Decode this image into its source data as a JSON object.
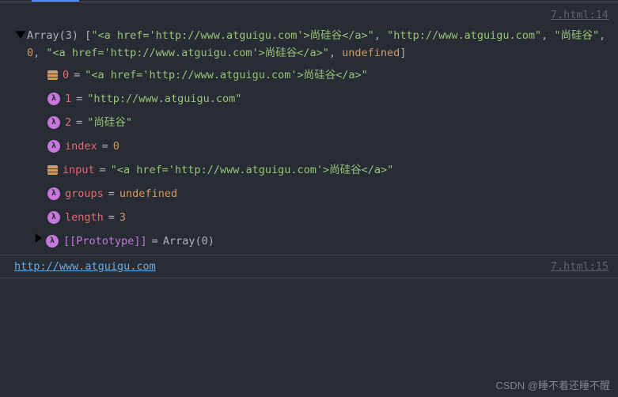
{
  "source1": "7.html:14",
  "source2": "7.html:15",
  "summary": {
    "prefix": "Array(3)",
    "items": [
      {
        "t": "string",
        "v": "\"<a href='http://www.atguigu.com'>尚硅谷</a>\""
      },
      {
        "t": "string",
        "v": "\"http://www.atguigu.com\""
      },
      {
        "t": "string",
        "v": "\"尚硅谷\""
      },
      {
        "t": "number",
        "v": "0"
      },
      {
        "t": "string",
        "v": "\"<a href='http://www.atguigu.com'>尚硅谷</a>\""
      },
      {
        "t": "undef",
        "v": "undefined"
      }
    ]
  },
  "props": [
    {
      "icon": "array",
      "key": "0",
      "val": "\"<a href='http://www.atguigu.com'>尚硅谷</a>\"",
      "vt": "string"
    },
    {
      "icon": "lambda",
      "key": "1",
      "val": "\"http://www.atguigu.com\"",
      "vt": "string"
    },
    {
      "icon": "lambda",
      "key": "2",
      "val": "\"尚硅谷\"",
      "vt": "string"
    },
    {
      "icon": "lambda",
      "key": "index",
      "val": "0",
      "vt": "number"
    },
    {
      "icon": "array",
      "key": "input",
      "val": "\"<a href='http://www.atguigu.com'>尚硅谷</a>\"",
      "vt": "string"
    },
    {
      "icon": "lambda",
      "key": "groups",
      "val": "undefined",
      "vt": "undef"
    },
    {
      "icon": "lambda",
      "key": "length",
      "val": "3",
      "vt": "number"
    }
  ],
  "proto": {
    "key": "[[Prototype]]",
    "val": "Array(0)"
  },
  "url": "http://www.atguigu.com",
  "watermark": "CSDN @睡不着还睡不醒"
}
